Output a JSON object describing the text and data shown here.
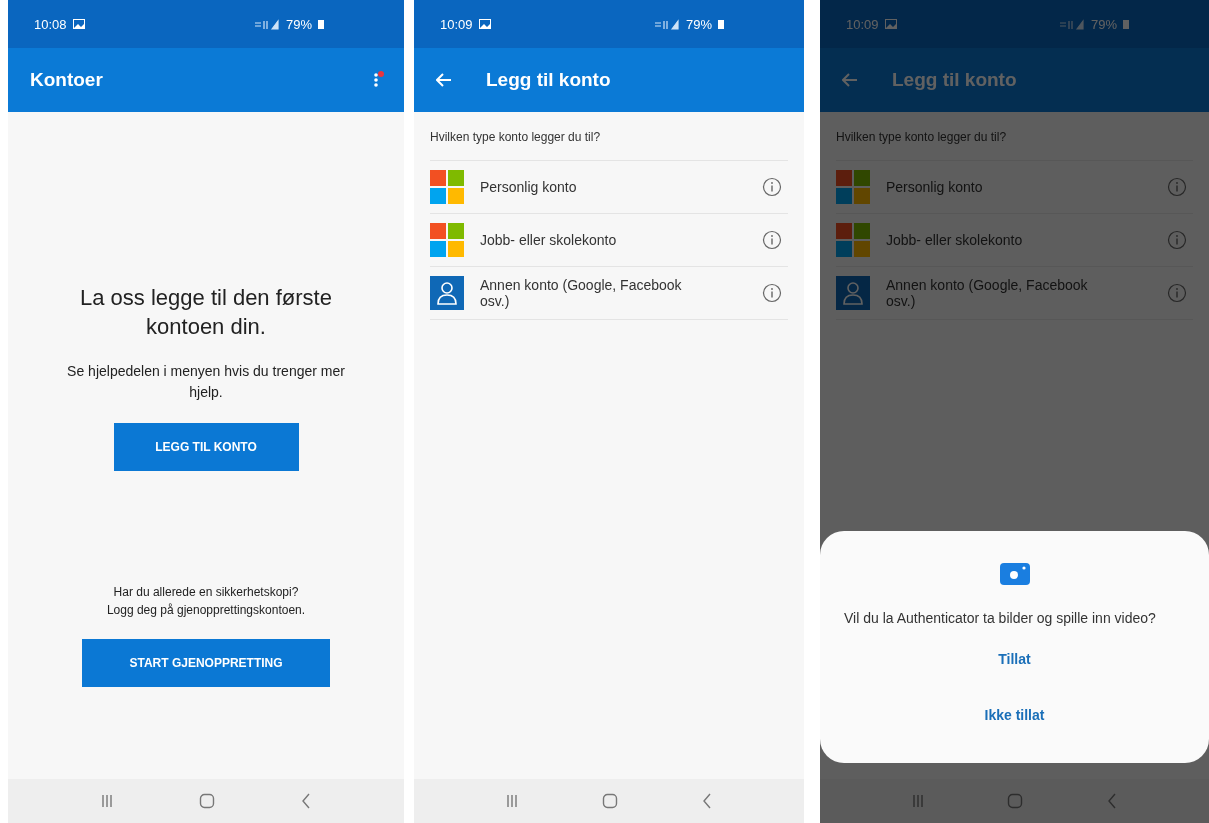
{
  "screens": [
    {
      "kind": "welcome",
      "status_bar": {
        "time": "10:08",
        "battery": "79%"
      },
      "app_bar": {
        "title": "Kontoer"
      },
      "heading": "La oss legge til den første kontoen din.",
      "hint": "Se hjelpedelen i menyen hvis du trenger mer hjelp.",
      "add_button": "LEGG TIL KONTO",
      "backup_lines": [
        "Har du allerede en sikkerhetskopi?",
        "Logg deg på gjenopprettingskontoen."
      ],
      "restore_button": "START GJENOPPRETTING"
    },
    {
      "kind": "choose",
      "status_bar": {
        "time": "10:09",
        "battery": "79%"
      },
      "app_bar": {
        "title": "Legg til konto"
      },
      "prompt": "Hvilken type konto legger du til?",
      "options": [
        {
          "label": "Personlig konto",
          "kind": "microsoft"
        },
        {
          "label": "Jobb- eller skolekonto",
          "kind": "microsoft"
        },
        {
          "label": "Annen konto (Google, Facebook osv.)",
          "kind": "other"
        }
      ]
    },
    {
      "kind": "choose",
      "status_bar": {
        "time": "10:09",
        "battery": "79%"
      },
      "app_bar": {
        "title": "Legg til konto"
      },
      "prompt": "Hvilken type konto legger du til?",
      "options": [
        {
          "label": "Personlig konto",
          "kind": "microsoft"
        },
        {
          "label": "Jobb- eller skolekonto",
          "kind": "microsoft"
        },
        {
          "label": "Annen konto (Google, Facebook osv.)",
          "kind": "other"
        }
      ],
      "dialog": {
        "message": "Vil du la Authenticator ta bilder og spille inn video?",
        "buttons": [
          "Tillat",
          "Ikke tillat"
        ]
      }
    }
  ]
}
